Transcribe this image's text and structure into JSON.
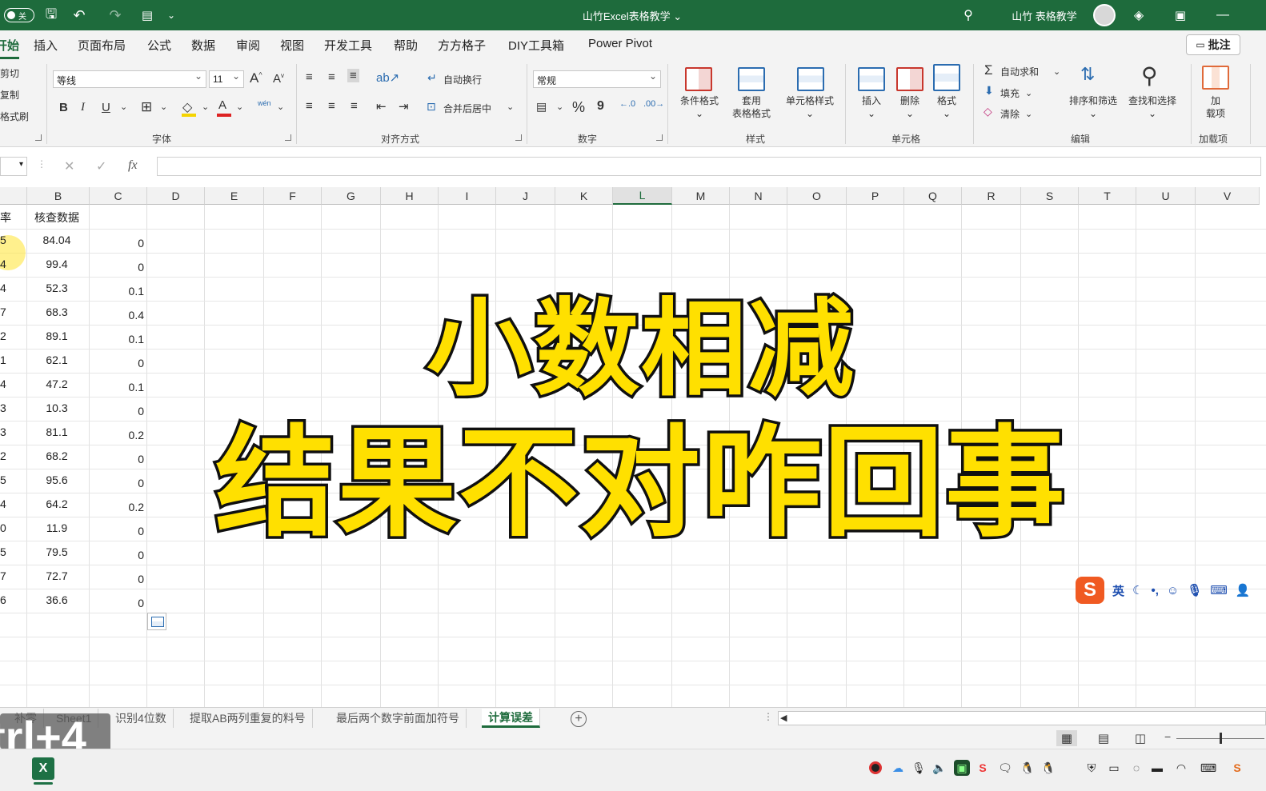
{
  "titlebar": {
    "autosave_state": "关",
    "doc_title": "山竹Excel表格教学 ⌄",
    "user_name": "山竹 表格教学"
  },
  "menu": {
    "tabs": [
      "开始",
      "插入",
      "页面布局",
      "公式",
      "数据",
      "审阅",
      "视图",
      "开发工具",
      "帮助",
      "方方格子",
      "DIY工具箱",
      "Power Pivot"
    ],
    "active": "开始",
    "comment_button": "批注"
  },
  "ribbon": {
    "clipboard": [
      "剪切",
      "复制",
      "格式刷"
    ],
    "font": {
      "name": "等线",
      "size": "11",
      "group_label": "字体",
      "bold": "B",
      "italic": "I",
      "underline": "U",
      "phonetic": "wén"
    },
    "alignment": {
      "wrap_text": "自动换行",
      "merge_center": "合并后居中",
      "group_label": "对齐方式"
    },
    "number": {
      "format": "常规",
      "percent": "%",
      "comma": "9",
      "group_label": "数字"
    },
    "styles": {
      "conditional": "条件格式",
      "format_table_1": "套用",
      "format_table_2": "表格格式",
      "cell_styles": "单元格样式",
      "group_label": "样式"
    },
    "cells": {
      "insert": "插入",
      "delete": "删除",
      "format": "格式",
      "group_label": "单元格"
    },
    "editing": {
      "autosum": "自动求和",
      "fill": "填充",
      "clear": "清除",
      "sort_filter": "排序和筛选",
      "find_select": "查找和选择",
      "group_label": "编辑"
    },
    "addins": {
      "label_1": "加",
      "label_2": "载项",
      "group_label": "加载项"
    }
  },
  "formula_bar": {
    "fx": "fx"
  },
  "grid": {
    "columns": [
      "B",
      "C",
      "D",
      "E",
      "F",
      "G",
      "H",
      "I",
      "J",
      "K",
      "L",
      "M",
      "N",
      "O",
      "P",
      "Q",
      "R",
      "S",
      "T",
      "U",
      "V"
    ],
    "selected_column": "L",
    "col_a_header_fragment": "率",
    "col_b_header": "核查数据",
    "col_a_fragments": [
      "5",
      "4",
      "4",
      "7",
      "2",
      "1",
      "4",
      "3",
      "3",
      "2",
      "5",
      "4",
      "0",
      "5",
      "7",
      "6"
    ],
    "col_b_values": [
      "84.04",
      "99.4",
      "52.3",
      "68.3",
      "89.1",
      "62.1",
      "47.2",
      "10.3",
      "81.1",
      "68.2",
      "95.6",
      "64.2",
      "11.9",
      "79.5",
      "72.7",
      "36.6"
    ],
    "col_c_values": [
      "0",
      "0",
      "0.1",
      "0.4",
      "0.1",
      "0",
      "0.1",
      "0",
      "0.2",
      "0",
      "0",
      "0.2",
      "0",
      "0",
      "0",
      "0"
    ]
  },
  "overlay": {
    "line1": "小数相减",
    "line2": "结果不对咋回事"
  },
  "ime": {
    "logo": "S",
    "lang": "英"
  },
  "sheets": {
    "tabs": [
      "补零",
      "Sheet1",
      "识别4位数",
      "提取AB两列重复的料号",
      "最后两个数字前面加符号",
      "计算误差"
    ],
    "active": "计算误差"
  },
  "key_hint": "trl+4"
}
